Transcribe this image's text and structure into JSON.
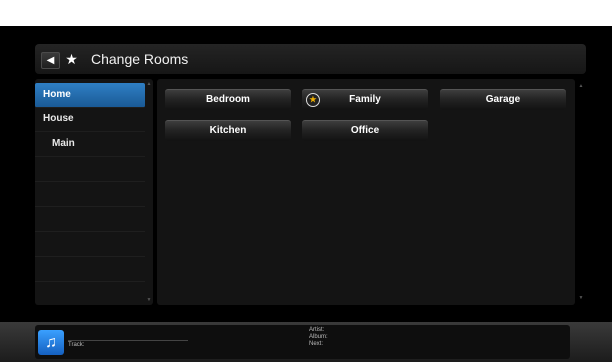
{
  "header": {
    "title": "Change Rooms",
    "back_icon": "back-arrow-icon",
    "fav_icon": "star-icon"
  },
  "sidebar": {
    "items": [
      {
        "label": "Home",
        "active": true
      },
      {
        "label": "House",
        "active": false
      },
      {
        "label": "Main",
        "active": false
      }
    ]
  },
  "rooms": [
    {
      "label": "Bedroom",
      "favorite": false
    },
    {
      "label": "Family",
      "favorite": true
    },
    {
      "label": "Garage",
      "favorite": false
    },
    {
      "label": "Kitchen",
      "favorite": false
    },
    {
      "label": "Office",
      "favorite": false
    }
  ],
  "player": {
    "track_label": "Track:",
    "artist_label": "Artist:",
    "album_label": "Album:",
    "next_label": "Next:"
  },
  "colors": {
    "accent": "#2a78bf",
    "background": "#000000"
  }
}
